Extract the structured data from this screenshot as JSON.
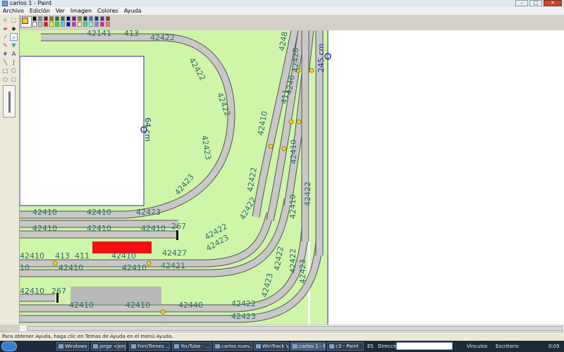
{
  "window": {
    "title": "carlos 1 - Paint"
  },
  "menu": [
    "Archivo",
    "Edición",
    "Ver",
    "Imagen",
    "Colores",
    "Ayuda"
  ],
  "palette": {
    "foreground": "#f7c325",
    "background": "#ffffff",
    "colors": [
      "#000000",
      "#808080",
      "#800000",
      "#808000",
      "#008000",
      "#008080",
      "#000080",
      "#800080",
      "#808040",
      "#004040",
      "#0080ff",
      "#004080",
      "#8000ff",
      "#804000",
      "#ffffff",
      "#c0c0c0",
      "#ff0000",
      "#ffff00",
      "#00ff00",
      "#00ffff",
      "#0000ff",
      "#ff00ff",
      "#ffff80",
      "#00ff80",
      "#80ffff",
      "#8080ff",
      "#ff0080",
      "#ff8040"
    ]
  },
  "tools": [
    "free-select",
    "select",
    "eraser",
    "fill",
    "picker",
    "magnifier",
    "pencil",
    "brush",
    "airbrush",
    "text",
    "line",
    "curve",
    "rectangle",
    "polygon",
    "ellipse",
    "rounded-rectangle"
  ],
  "canvas": {
    "background_green": "#cff5a8",
    "track_gray": "#c8c8c8",
    "label_color": "#2a6b6b",
    "measure_left": "64 cm",
    "measure_right": "245 cm",
    "labels": [
      "42141",
      "413",
      "42422",
      "42422",
      "42422",
      "4248",
      "42423",
      "42423",
      "42410",
      "42410",
      "42410",
      "42410",
      "42410",
      "42410",
      "42423",
      "267",
      "42410",
      "413",
      "411",
      "42410",
      "42427",
      "42421",
      "10",
      "42410",
      "42410",
      "42423",
      "42422",
      "42422",
      "42422",
      "42410",
      "267",
      "42410",
      "42410",
      "42440",
      "42422",
      "42423",
      "42423",
      "411",
      "4240",
      "42410",
      "42422",
      "42422",
      "42428",
      "42423",
      "42422",
      "42410"
    ]
  },
  "statusbar": {
    "text": "Para obtener Ayuda, haga clic en Temas de Ayuda en el menú Ayuda."
  },
  "taskbar": {
    "items": [
      "Windows Li...",
      "jorge <jorg...",
      "ForoTrenes ...",
      "YouTube - ...",
      "carlos nuev...",
      "WinTrack V...",
      "carlos 1 - P...",
      "c3 - Paint"
    ],
    "lang": "ES",
    "address_label": "Dirección",
    "links_label": "Vínculos",
    "desktop_label": "Escritorio",
    "clock": "0:05"
  }
}
